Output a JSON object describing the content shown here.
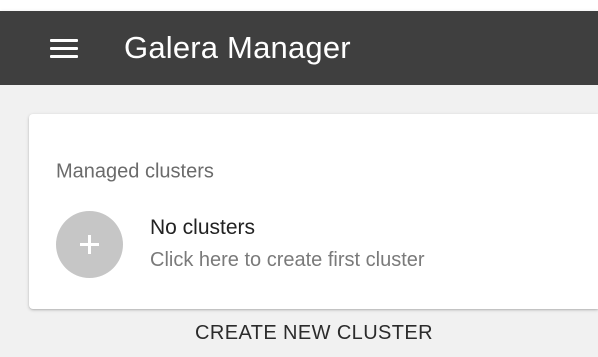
{
  "appbar": {
    "menu_icon": "hamburger-menu-icon",
    "title": "Galera Manager",
    "background": "#3f3f3f"
  },
  "clusters_card": {
    "header": "Managed clusters",
    "empty_state": {
      "icon": "plus-icon",
      "title": "No clusters",
      "subtitle": "Click here to create first cluster"
    }
  },
  "actions": {
    "create_label": "CREATE NEW CLUSTER"
  }
}
